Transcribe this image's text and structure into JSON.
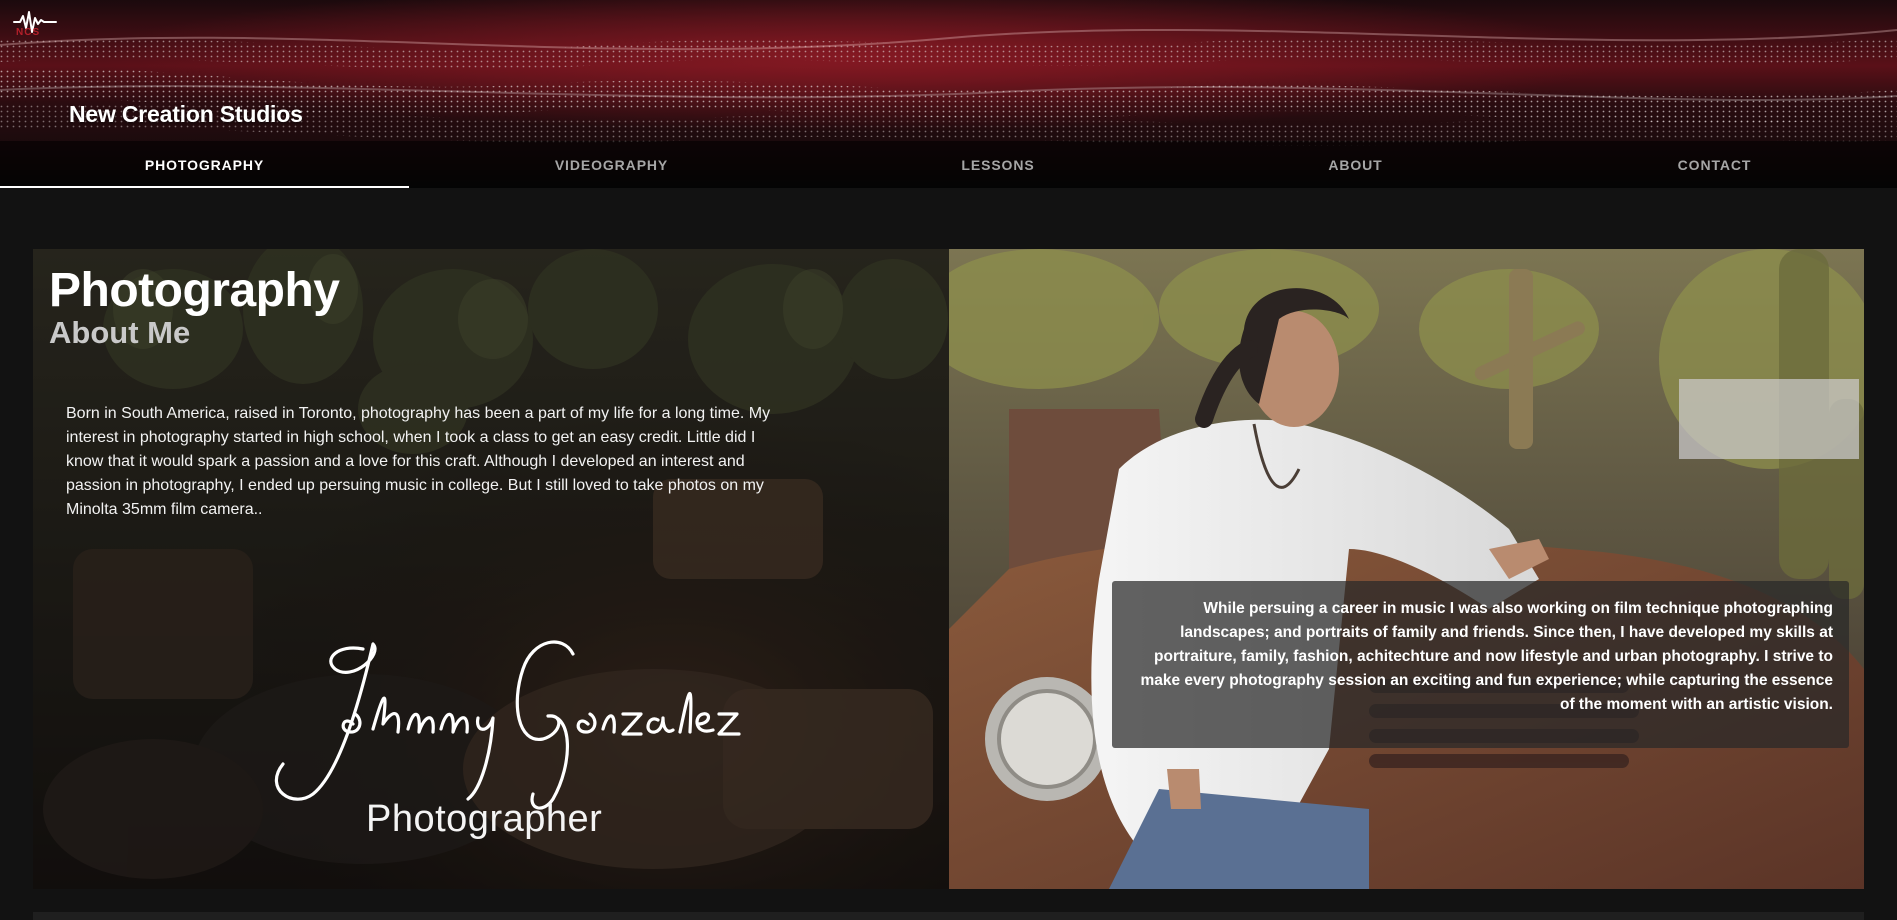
{
  "header": {
    "logo_text": "NCS",
    "site_title": "New Creation Studios"
  },
  "nav": {
    "tabs": [
      {
        "label": "PHOTOGRAPHY",
        "active": true
      },
      {
        "label": "VIDEOGRAPHY",
        "active": false
      },
      {
        "label": "LESSONS",
        "active": false
      },
      {
        "label": "ABOUT",
        "active": false
      },
      {
        "label": "CONTACT",
        "active": false
      }
    ]
  },
  "main": {
    "title": "Photography",
    "subtitle": "About Me",
    "bio_intro": "Born in South America, raised in Toronto, photography has been a part of my life for a long time. My interest in photography started in high school, when I took a class to get an easy credit. Little did I know that it would spark a passion and a love for this craft. Although I developed an interest and passion in photography, I ended up persuing music in college. But I still loved to take photos on my Minolta 35mm film camera..",
    "signature_name": "Johnny Gonzalez",
    "signature_role": "Photographer",
    "bio_continued": "While persuing a career in music I was also working on film technique photographing landscapes; and portraits of family and friends. Since then, I have developed my skills at portraiture, family, fashion, achitechture and now lifestyle and urban photography. I strive to make every photography session an exciting and fun experience; while capturing the essence of the moment with an artistic vision."
  },
  "colors": {
    "background": "#121212",
    "accent_red": "#b3202a",
    "nav_active": "#ffffff",
    "nav_inactive": "#a6a6a6"
  },
  "icons": {
    "logo": "soundwave-logo-icon"
  }
}
